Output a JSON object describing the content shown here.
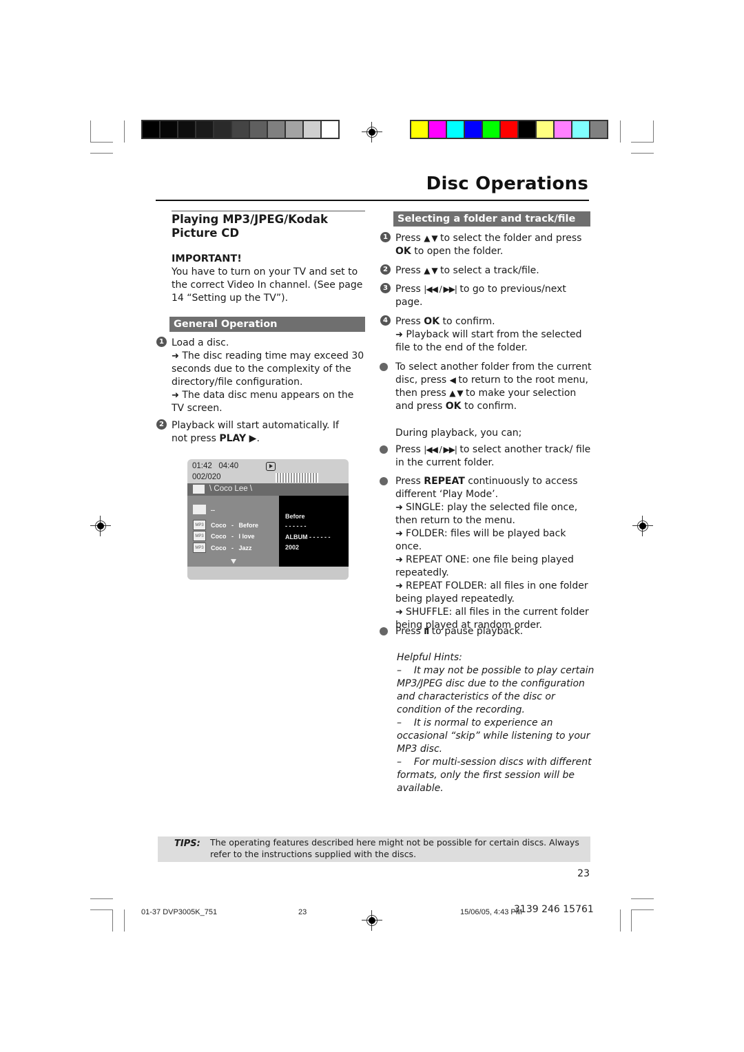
{
  "print_marks": {
    "grayscale_swatches": [
      "#000000",
      "#060606",
      "#0e0e0e",
      "#1a1a1a",
      "#2a2a2a",
      "#444444",
      "#5f5f5f",
      "#808080",
      "#a3a3a3",
      "#cfcfcf",
      "#ffffff"
    ],
    "color_swatches": [
      "#ffff00",
      "#ff00ff",
      "#00ffff",
      "#0000ff",
      "#00ff00",
      "#ff0000",
      "#000000",
      "#ffff80",
      "#ff80ff",
      "#80ffff",
      "#808080"
    ]
  },
  "page": {
    "title": "Disc Operations",
    "page_number": "23"
  },
  "left": {
    "heading": "Playing MP3/JPEG/Kodak Picture CD",
    "important_label": "IMPORTANT!",
    "important_text": "You have to turn on your TV and set to the correct Video In channel.  (See page 14 “Setting up the TV”).",
    "general_heading": "General Operation",
    "steps": [
      {
        "num": "1",
        "text": "Load a disc.",
        "notes": [
          "The disc reading time may exceed 30 seconds due to the complexity of the directory/file configuration.",
          "The data disc menu appears on the TV screen."
        ]
      },
      {
        "num": "2",
        "text_before": "Playback will start automatically. If not press ",
        "bold": "PLAY",
        "icon": "play-icon",
        "text_after": "."
      }
    ],
    "tv_screen": {
      "elapsed": "01:42",
      "total": "04:40",
      "track_count": "002/020",
      "path": "\\ Coco Lee \\",
      "parent_entry": "--",
      "files": [
        {
          "type": "MP3",
          "artist": "Coco",
          "sep": "-",
          "title": "Before"
        },
        {
          "type": "MP3",
          "artist": "Coco",
          "sep": "-",
          "title": "I love"
        },
        {
          "type": "MP3",
          "artist": "Coco",
          "sep": "-",
          "title": "Jazz"
        }
      ],
      "info": [
        "Before",
        "- - - - - -",
        "ALBUM - - - - - -",
        "2002"
      ]
    }
  },
  "right": {
    "heading": "Selecting a folder and track/file",
    "steps": [
      {
        "num": "1",
        "html_parts": [
          "Press ",
          "▲ ▼",
          " to select the folder and press ",
          "OK",
          " to open the folder."
        ]
      },
      {
        "num": "2",
        "html_parts": [
          "Press ",
          "▲ ▼",
          " to select a track/file."
        ]
      },
      {
        "num": "3",
        "html_parts": [
          "Press ",
          "|◀◀ / ▶▶|",
          " to go to previous/next page."
        ]
      },
      {
        "num": "4",
        "html_parts": [
          "Press ",
          "OK",
          " to confirm."
        ],
        "note": "Playback will start from the selected file to the end of the folder."
      }
    ],
    "bullet_folder": [
      "To select another folder from the current disc, press ",
      "◀",
      " to return to the root menu, then press ",
      "▲ ▼",
      " to make your selection and press ",
      "OK",
      " to confirm."
    ],
    "during_playback": "During playback, you can;",
    "bullet_skip": [
      "Press ",
      "|◀◀ / ▶▶|",
      " to select another track/ file in the current folder."
    ],
    "bullet_repeat": [
      "Press ",
      "REPEAT",
      " continuously to access different ‘Play Mode’."
    ],
    "repeat_modes": [
      "SINGLE: play the selected file once, then return to the menu.",
      "FOLDER: files will be played back once.",
      "REPEAT ONE: one file being played repeatedly.",
      "REPEAT FOLDER: all files in one folder being played repeatedly.",
      "SHUFFLE: all files in the current folder being played at random order."
    ],
    "bullet_pause": [
      "Press ",
      "II",
      " to pause playback."
    ],
    "hints_title": "Helpful Hints:",
    "hints": [
      "It may not be possible to play certain MP3/JPEG disc due to the configuration and characteristics of the disc or condition of the recording.",
      "It is normal to experience an occasional “skip” while listening to your MP3 disc.",
      "For multi-session discs with different formats, only the first session will be available."
    ]
  },
  "tips": {
    "label": "TIPS:",
    "text": "The operating features described here might not be possible for certain discs.  Always refer to the instructions supplied with the discs."
  },
  "footer": {
    "file": "01-37 DVP3005K_751",
    "page": "23",
    "date": "15/06/05, 4:43 PM",
    "code": "3139 246 15761"
  }
}
